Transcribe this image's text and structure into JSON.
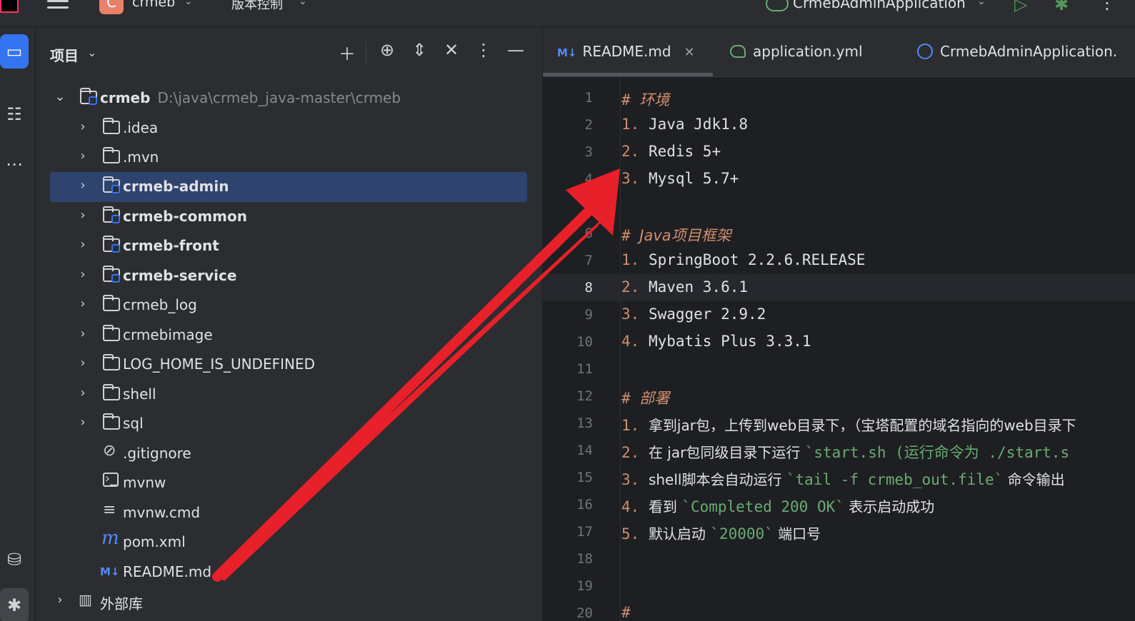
{
  "titlebar": {
    "project_badge": "C",
    "project_name": "crmeb",
    "vcs_label": "版本控制",
    "run_config": "CrmebAdminApplication"
  },
  "project_panel": {
    "title": "项目",
    "root": {
      "name": "crmeb",
      "path": "D:\\java\\crmeb_java-master\\crmeb"
    },
    "items": [
      {
        "label": "idea_display",
        "text": ".idea"
      },
      {
        "text": ".mvn"
      },
      {
        "text": "crmeb-admin"
      },
      {
        "text": "crmeb-common"
      },
      {
        "text": "crmeb-front"
      },
      {
        "text": "crmeb-service"
      },
      {
        "text": "crmeb_log"
      },
      {
        "text": "crmebimage"
      },
      {
        "text": "LOG_HOME_IS_UNDEFINED"
      },
      {
        "text": "shell"
      },
      {
        "text": "sql"
      },
      {
        "text": ".gitignore"
      },
      {
        "text": "mvnw"
      },
      {
        "text": "mvnw.cmd"
      },
      {
        "text": "pom.xml"
      },
      {
        "text": "README.md"
      }
    ],
    "external_libs": "外部库"
  },
  "editor": {
    "tabs": [
      {
        "label": "README.md",
        "badge": "M↓"
      },
      {
        "label": "application.yml"
      },
      {
        "label": "CrmebAdminApplication."
      }
    ],
    "current_line": 8,
    "lines": [
      {
        "n": "1",
        "hash": "#",
        "head": "环境"
      },
      {
        "n": "2",
        "marker": "1.",
        "text": "Java Jdk1.8"
      },
      {
        "n": "3",
        "marker": "2.",
        "text": "Redis 5+"
      },
      {
        "n": "4",
        "marker": "3.",
        "text": "Mysql 5.7+"
      },
      {
        "n": "5"
      },
      {
        "n": "6",
        "hash": "#",
        "head": "Java项目框架"
      },
      {
        "n": "7",
        "marker": "1.",
        "text": "SpringBoot 2.2.6.RELEASE"
      },
      {
        "n": "8",
        "marker": "2.",
        "text": "Maven 3.6.1"
      },
      {
        "n": "9",
        "marker": "3.",
        "text": "Swagger 2.9.2"
      },
      {
        "n": "10",
        "marker": "4.",
        "text": "Mybatis Plus 3.3.1"
      },
      {
        "n": "11"
      },
      {
        "n": "12",
        "hash": "#",
        "head": "部署"
      },
      {
        "n": "13",
        "marker": "1.",
        "text": "拿到jar包，上传到web目录下，（宝塔配置的域名指向的web目录下"
      },
      {
        "n": "14",
        "marker": "2.",
        "text": "在 jar包同级目录下运行 ",
        "code": "`start.sh (运行命令为 ./start.s"
      },
      {
        "n": "15",
        "marker": "3.",
        "text": "shell脚本会自动运行 ",
        "code": "`tail -f crmeb_out.file`",
        "tail": " 命令输出"
      },
      {
        "n": "16",
        "marker": "4.",
        "text": "看到 ",
        "code": "`Completed 200 OK`",
        "tail": " 表示启动成功"
      },
      {
        "n": "17",
        "marker": "5.",
        "text": "默认启动 ",
        "code": "`20000`",
        "tail": " 端口号"
      },
      {
        "n": "18"
      },
      {
        "n": "19"
      },
      {
        "n": "20",
        "hash": "#"
      }
    ]
  },
  "colors": {
    "accent": "#3574f0",
    "selection": "#2e436e",
    "markdown_heading": "#cf8e6d",
    "inline_code": "#6aab73",
    "annotation_arrow": "#e8202a"
  }
}
